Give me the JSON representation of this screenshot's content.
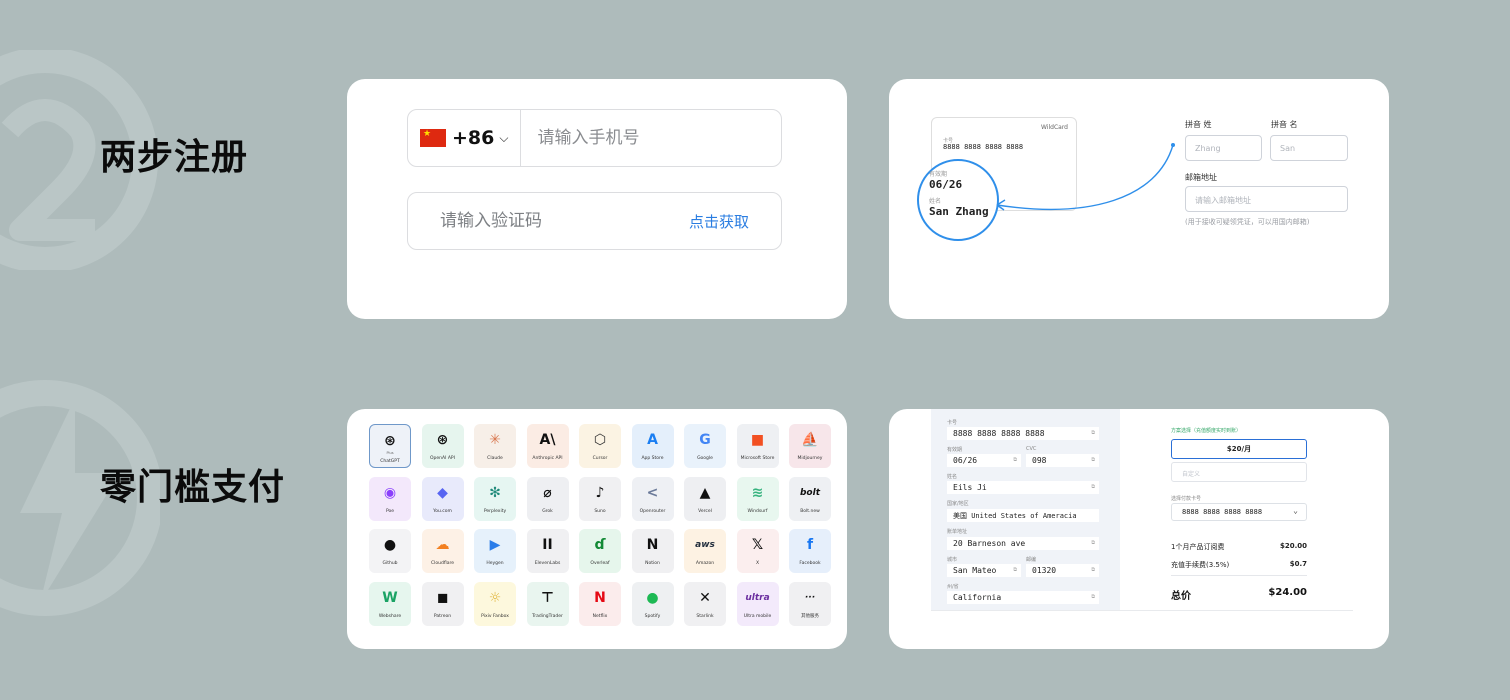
{
  "colors": {
    "background": "#aebbbb",
    "accent": "#2a7de1",
    "card": "#ffffff",
    "highlight": "#2f8fea"
  },
  "features": [
    {
      "title": "两步注册",
      "bg_icon": "number-two-icon"
    },
    {
      "title": "零门槛支付",
      "bg_icon": "lightning-icon"
    }
  ],
  "phone_form": {
    "flag_icon": "china-flag-icon",
    "country_code": "+86",
    "phone_placeholder": "请输入手机号",
    "code_placeholder": "请输入验证码",
    "get_code_label": "点击获取"
  },
  "card_form": {
    "card_brand": "WildCard",
    "card_number_label": "卡号",
    "card_number": "8888 8888 8888 8888",
    "expiry_label": "有效期",
    "expiry": "06/26",
    "name_label": "姓名",
    "name": "San Zhang",
    "last_name_label": "拼音 姓",
    "first_name_label": "拼音 名",
    "last_name_placeholder": "Zhang",
    "first_name_placeholder": "San",
    "email_label": "邮箱地址",
    "email_placeholder": "请输入邮箱地址",
    "email_note": "(用于接收可疑领凭证，可以用国内邮箱)"
  },
  "apps": [
    {
      "name": "ChatGPT",
      "pre": "Plus",
      "icon": "⊛",
      "bg": "#eef2f8",
      "fg": "#111",
      "selected": true
    },
    {
      "name": "OpenAI API",
      "icon": "⊛",
      "bg": "#e6f5ee",
      "fg": "#111"
    },
    {
      "name": "Claude",
      "icon": "✳",
      "bg": "#f7efe8",
      "fg": "#d9774f"
    },
    {
      "name": "Anthropic API",
      "icon": "A\\",
      "bg": "#fbece4",
      "fg": "#111"
    },
    {
      "name": "Cursor",
      "icon": "⬡",
      "bg": "#fbf3e3",
      "fg": "#333"
    },
    {
      "name": "App Store",
      "icon": "A",
      "bg": "#e4effb",
      "fg": "#1a7ef2"
    },
    {
      "name": "Google",
      "icon": "G",
      "bg": "#e9f2fb",
      "fg": "#4285f4"
    },
    {
      "name": "Microsoft Store",
      "icon": "■",
      "bg": "#eef0f3",
      "fg": "#f25022"
    },
    {
      "name": "Midjourney",
      "icon": "⛵",
      "bg": "#f7e6ea",
      "fg": "#333"
    },
    {
      "name": "Poe",
      "icon": "◉",
      "bg": "#f3e8fb",
      "fg": "#8a3ffc"
    },
    {
      "name": "You.com",
      "icon": "◆",
      "bg": "#e8eafb",
      "fg": "#5865f2"
    },
    {
      "name": "Perplexity",
      "icon": "✻",
      "bg": "#e6f6f2",
      "fg": "#1f8a7a"
    },
    {
      "name": "Grok",
      "icon": "⌀",
      "bg": "#eeeff2",
      "fg": "#111"
    },
    {
      "name": "Suno",
      "icon": "♪",
      "bg": "#f0f0f2",
      "fg": "#111"
    },
    {
      "name": "Openrouter",
      "icon": "<",
      "bg": "#eef0f4",
      "fg": "#6b7a99"
    },
    {
      "name": "Vercel",
      "icon": "▲",
      "bg": "#eeeff2",
      "fg": "#111"
    },
    {
      "name": "Windsurf",
      "icon": "≋",
      "bg": "#e8f7ef",
      "fg": "#36b37e"
    },
    {
      "name": "Bolt.new",
      "icon": "bolt",
      "bg": "#eef0f3",
      "fg": "#111"
    },
    {
      "name": "Github",
      "icon": "●",
      "bg": "#f3f3f5",
      "fg": "#111"
    },
    {
      "name": "Cloudflare",
      "icon": "☁",
      "bg": "#fdf1e6",
      "fg": "#f38020"
    },
    {
      "name": "Heygen",
      "icon": "▶",
      "bg": "#e6f1fb",
      "fg": "#2b7de9"
    },
    {
      "name": "ElevenLabs",
      "icon": "II",
      "bg": "#f0f0f2",
      "fg": "#111"
    },
    {
      "name": "Overleaf",
      "icon": "ɗ",
      "bg": "#e6f6ec",
      "fg": "#138a36"
    },
    {
      "name": "Notion",
      "icon": "N",
      "bg": "#f0f0f2",
      "fg": "#111"
    },
    {
      "name": "Amazon",
      "icon": "aws",
      "bg": "#fdf2e3",
      "fg": "#232f3e"
    },
    {
      "name": "X",
      "icon": "𝕏",
      "bg": "#fbeeee",
      "fg": "#111"
    },
    {
      "name": "Facebook",
      "icon": "f",
      "bg": "#e6effb",
      "fg": "#1877f2"
    },
    {
      "name": "Webshare",
      "icon": "W",
      "bg": "#e6f6ee",
      "fg": "#1aa364"
    },
    {
      "name": "Patreon",
      "icon": "◼",
      "bg": "#f0f0f2",
      "fg": "#111"
    },
    {
      "name": "Pixiv Fanbox",
      "icon": "☼",
      "bg": "#fdf8dd",
      "fg": "#e0b43a"
    },
    {
      "name": "TradingTrader",
      "icon": "⊤",
      "bg": "#e9f5ef",
      "fg": "#111"
    },
    {
      "name": "Netflix",
      "icon": "N",
      "bg": "#fbecec",
      "fg": "#e50914"
    },
    {
      "name": "Spotify",
      "icon": "●",
      "bg": "#eef0f2",
      "fg": "#1db954"
    },
    {
      "name": "Starlink",
      "icon": "✕",
      "bg": "#f0f0f2",
      "fg": "#111"
    },
    {
      "name": "Ultra mobile",
      "icon": "ultra",
      "bg": "#f3eafb",
      "fg": "#6b2fa0"
    },
    {
      "name": "其他服务",
      "icon": "···",
      "bg": "#f0f0f2",
      "fg": "#111"
    }
  ],
  "checkout": {
    "card_number_label": "卡号",
    "card_number": "8888 8888 8888 8888",
    "expiry_label": "有效期",
    "expiry": "06/26",
    "cvc_label": "CVC",
    "cvc": "098",
    "name_label": "姓名",
    "name": "Eils Ji",
    "country_label": "国家/地区",
    "country": "美国 United States of Ameracia",
    "address_label": "账单地址",
    "address": "20 Barneson ave",
    "city_label": "城市",
    "city": "San Mateo",
    "zip_label": "邮编",
    "zip": "01320",
    "state_label": "州/省",
    "state": "California",
    "plan_label": "方案选择（充值额度实时到账）",
    "plan": "$20/月",
    "custom_placeholder": "自定义",
    "select_card_label": "选择付款卡号",
    "selected_card": "8888 8888 8888 8888",
    "line1_label": "1个月产品订阅费",
    "line1_value": "$20.00",
    "line2_label": "充值手续费(3.5%)",
    "line2_value": "$0.7",
    "total_label": "总价",
    "total_value": "$24.00"
  }
}
